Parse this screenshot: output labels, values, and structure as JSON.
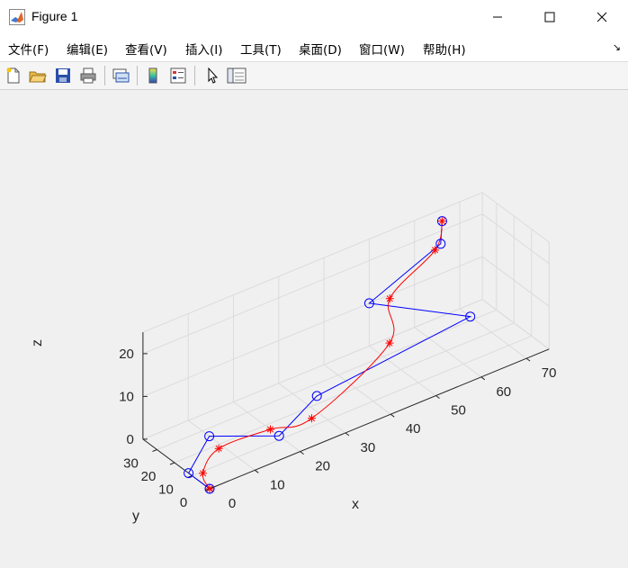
{
  "window": {
    "title": "Figure 1",
    "controls": {
      "minimize": "─",
      "maximize": "☐",
      "close": "✕"
    }
  },
  "menu": {
    "items": [
      "文件(F)",
      "编辑(E)",
      "查看(V)",
      "插入(I)",
      "工具(T)",
      "桌面(D)",
      "窗口(W)",
      "帮助(H)"
    ],
    "overflow_icon": "↘"
  },
  "toolbar": {
    "buttons": [
      "new-figure-icon",
      "open-file-icon",
      "save-icon",
      "print-icon",
      "link-plot-icon",
      "colorbar-icon",
      "legend-icon",
      "pointer-icon",
      "property-inspector-icon"
    ]
  },
  "colors": {
    "control_polygon": "#0000ff",
    "curve": "#ff0000",
    "grid": "#dcdcdc",
    "axis_text": "#262626"
  },
  "chart_data": {
    "type": "line3d",
    "xlabel": "x",
    "ylabel": "y",
    "zlabel": "z",
    "xlim": [
      0,
      75
    ],
    "ylim": [
      0,
      38
    ],
    "zlim": [
      0,
      25
    ],
    "xticks": [
      0,
      10,
      20,
      30,
      40,
      50,
      60,
      70
    ],
    "yticks": [
      0,
      10,
      20,
      30
    ],
    "zticks": [
      0,
      10,
      20
    ],
    "grid": true,
    "series": [
      {
        "marker": "circle",
        "color": "#0000ff",
        "points": [
          [
            0,
            0,
            0
          ],
          [
            0,
            12,
            0
          ],
          [
            10,
            26,
            0
          ],
          [
            20,
            12,
            0
          ],
          [
            33,
            24,
            0
          ],
          [
            70,
            32,
            0
          ],
          [
            50,
            38,
            10
          ],
          [
            65,
            36,
            18
          ],
          [
            63,
            30,
            26
          ]
        ]
      },
      {
        "marker": "asterisk",
        "color": "#ff0000",
        "points": [
          [
            0,
            0,
            0
          ],
          [
            2,
            9,
            0
          ],
          [
            9,
            18,
            0
          ],
          [
            20,
            17,
            0
          ],
          [
            28,
            14,
            0
          ],
          [
            51,
            29,
            3
          ],
          [
            53,
            34,
            11
          ],
          [
            63,
            34,
            18
          ],
          [
            63,
            30,
            26
          ]
        ]
      }
    ]
  }
}
